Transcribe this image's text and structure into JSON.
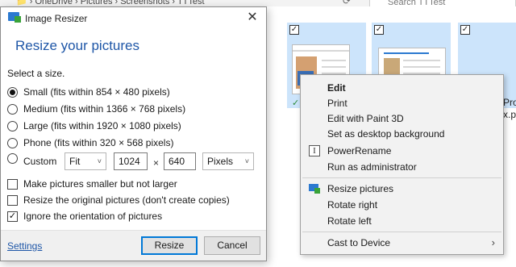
{
  "explorer": {
    "breadcrumb": "📁  ›  OneDrive  ›  Pictures  ›  Screenshots  ›  TTTest",
    "nav_refresh": "⟳",
    "search_placeholder": "Search TTTest",
    "tile_text_1": "Pro",
    "tile_text_2": "x.p"
  },
  "dialog": {
    "title": "Image Resizer",
    "close_glyph": "✕",
    "heading": "Resize your pictures",
    "select_label": "Select a size.",
    "sizes": [
      {
        "label": "Small (fits within 854 × 480 pixels)",
        "checked": true
      },
      {
        "label": "Medium (fits within 1366 × 768 pixels)",
        "checked": false
      },
      {
        "label": "Large (fits within 1920 × 1080 pixels)",
        "checked": false
      },
      {
        "label": "Phone (fits within 320 × 568 pixels)",
        "checked": false
      }
    ],
    "custom": {
      "label": "Custom",
      "fit_value": "Fit",
      "width_value": "1024",
      "times": "×",
      "height_value": "640",
      "unit_value": "Pixels"
    },
    "options": [
      {
        "label": "Make pictures smaller but not larger",
        "checked": false
      },
      {
        "label": "Resize the original pictures (don't create copies)",
        "checked": false
      },
      {
        "label": "Ignore the orientation of pictures",
        "checked": true
      }
    ],
    "settings_link": "Settings",
    "resize_button": "Resize",
    "cancel_button": "Cancel"
  },
  "context_menu": {
    "items": [
      {
        "label": "Edit",
        "bold": true
      },
      {
        "label": "Print"
      },
      {
        "label": "Edit with Paint 3D"
      },
      {
        "label": "Set as desktop background"
      },
      {
        "label": "PowerRename",
        "icon": "power-rename-icon"
      },
      {
        "label": "Run as administrator"
      },
      {
        "label": "Resize pictures",
        "icon": "image-resizer-icon"
      },
      {
        "label": "Rotate right"
      },
      {
        "label": "Rotate left"
      },
      {
        "label": "Cast to Device",
        "submenu": true
      }
    ],
    "submenu_glyph": "›",
    "power_rename_glyph": "I"
  },
  "colors": {
    "accent": "#1e56a7",
    "selection": "#cce4fb",
    "menu_bg": "#f2f2f2"
  }
}
